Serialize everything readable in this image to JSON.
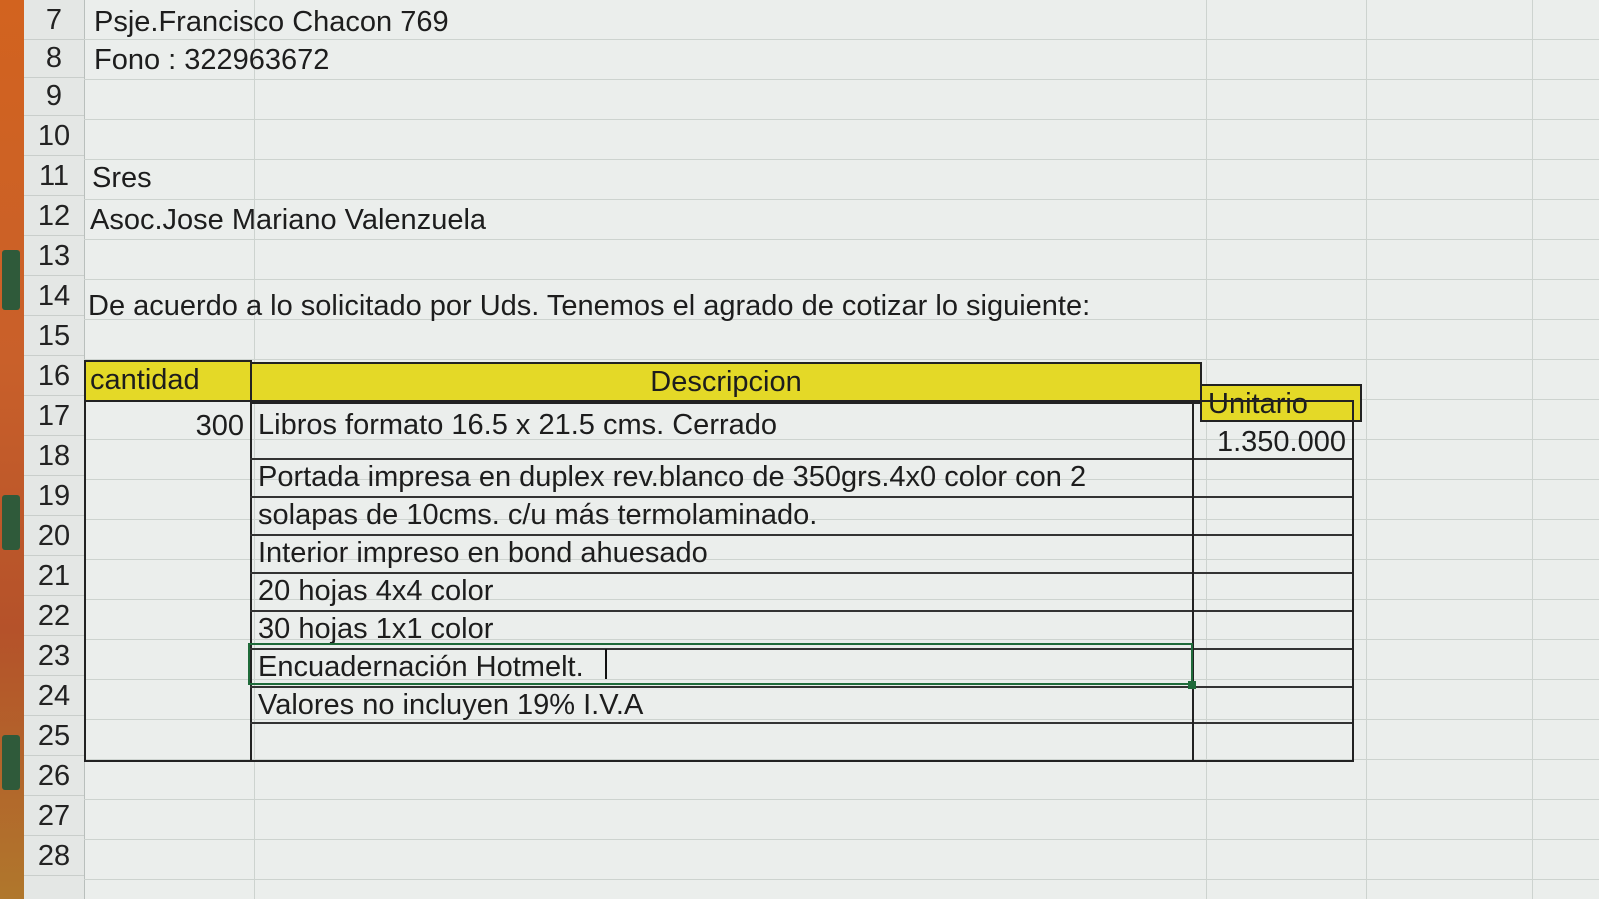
{
  "rows": [
    "7",
    "8",
    "9",
    "10",
    "11",
    "12",
    "13",
    "14",
    "15",
    "16",
    "17",
    "18",
    "19",
    "20",
    "21",
    "22",
    "23",
    "24",
    "25",
    "26",
    "27",
    "28"
  ],
  "header": {
    "address": "Psje.Francisco Chacon 769",
    "phone": "Fono : 322963672",
    "salutation": "Sres",
    "client": "Asoc.Jose Mariano Valenzuela",
    "intro": "De acuerdo a lo solicitado por Uds. Tenemos el agrado de cotizar lo siguiente:"
  },
  "table": {
    "col_quantity": "cantidad",
    "col_description": "Descripcion",
    "col_unit": "Unitario",
    "quantity": "300",
    "unit_price": "1.350.000",
    "lines": [
      "Libros formato 16.5 x 21.5 cms. Cerrado",
      "Portada impresa en duplex rev.blanco de 350grs.4x0 color con  2",
      "solapas de 10cms. c/u más termolaminado.",
      "Interior impreso en bond ahuesado",
      "20 hojas 4x4 color",
      "30 hojas 1x1 color",
      "Encuadernación Hotmelt.",
      "Valores no incluyen 19% I.V.A"
    ]
  },
  "colors": {
    "header_fill": "#e4d927",
    "selection": "#1f6b3a"
  }
}
